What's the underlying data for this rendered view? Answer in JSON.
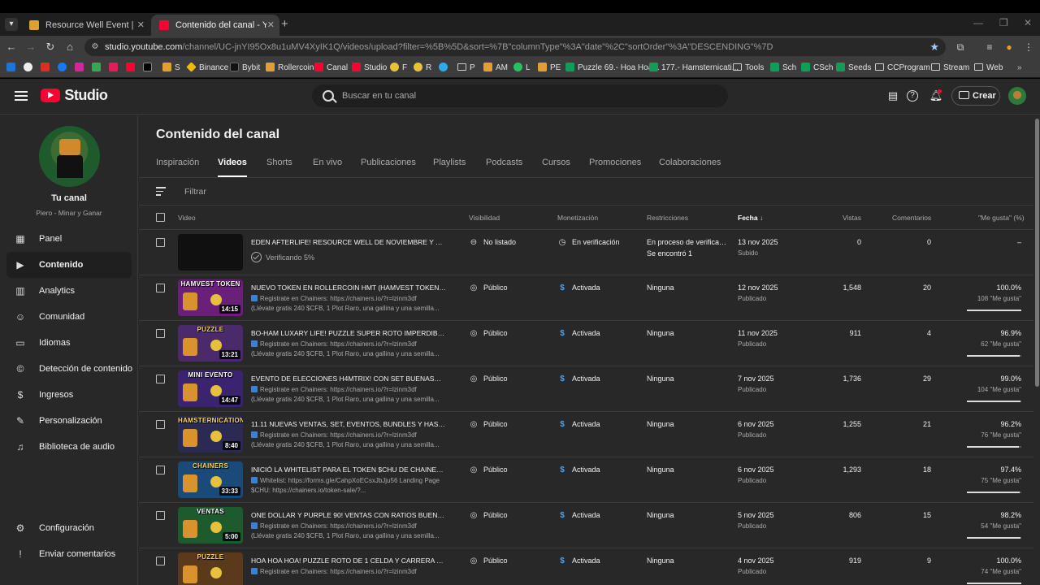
{
  "browser": {
    "tabs": [
      {
        "title": "Resource Well Event | RollerCoin",
        "active": false
      },
      {
        "title": "Contenido del canal - YouTube",
        "active": true
      }
    ],
    "url_main": "studio.youtube.com",
    "url_rest": "/channel/UC-jnYI95Ox8u1uMV4XyIK1Q/videos/upload?filter=%5B%5D&sort=%7B\"columnType\"%3A\"date\"%2C\"sortOrder\"%3A\"DESCENDING\"%7D",
    "bookmarks": [
      "S",
      "Binance",
      "Bybit",
      "Rollercoin",
      "Canal",
      "Studio",
      "F",
      "R",
      "P",
      "AM",
      "L",
      "PE",
      "Puzzle 69.- Hoa Hoa...",
      "177.- Hamsternicati...",
      "Tools",
      "Sch",
      "CSch",
      "Seeds",
      "CCProgram",
      "Stream",
      "Web"
    ]
  },
  "header": {
    "brand": "Studio",
    "search_placeholder": "Buscar en tu canal",
    "create_label": "Crear"
  },
  "sidebar": {
    "channel_title": "Tu canal",
    "channel_name": "Piero - Minar y Ganar",
    "items": [
      {
        "label": "Panel",
        "icon": "dashboard-icon"
      },
      {
        "label": "Contenido",
        "icon": "content-icon"
      },
      {
        "label": "Analytics",
        "icon": "analytics-icon"
      },
      {
        "label": "Comunidad",
        "icon": "community-icon"
      },
      {
        "label": "Idiomas",
        "icon": "subtitles-icon"
      },
      {
        "label": "Detección de contenido",
        "icon": "copyright-icon"
      },
      {
        "label": "Ingresos",
        "icon": "dollar-icon"
      },
      {
        "label": "Personalización",
        "icon": "magic-wand-icon"
      },
      {
        "label": "Biblioteca de audio",
        "icon": "audio-library-icon"
      }
    ],
    "bottom": [
      {
        "label": "Configuración",
        "icon": "gear-icon"
      },
      {
        "label": "Enviar comentarios",
        "icon": "feedback-icon"
      }
    ]
  },
  "content": {
    "title": "Contenido del canal",
    "tabs": [
      "Inspiración",
      "Videos",
      "Shorts",
      "En vivo",
      "Publicaciones",
      "Playlists",
      "Podcasts",
      "Cursos",
      "Promociones",
      "Colaboraciones"
    ],
    "active_tab": "Videos",
    "filter_placeholder": "Filtrar",
    "columns": {
      "video": "Video",
      "visibility": "Visibilidad",
      "monetization": "Monetización",
      "restrictions": "Restricciones",
      "date": "Fecha",
      "views": "Vistas",
      "comments": "Comentarios",
      "likes": "\"Me gusta\" (%)"
    },
    "rows": [
      {
        "thumb_text": "",
        "duration": "",
        "title": "EDEN AFTERLIFE! RESOURCE WELL DE NOVIEMBRE Y CHIS...",
        "desc1": "",
        "desc2": "",
        "processing": "Verificando 5%",
        "visibility": "No listado",
        "monetization": "En verificación",
        "restrictions": "En proceso de verificac...",
        "restrictions2": "Se encontró 1",
        "date": "13 nov 2025",
        "date_status": "Subido",
        "views": "0",
        "comments": "0",
        "likes_pct": "–",
        "likes_count": "",
        "likes_ratio": null
      },
      {
        "thumb_text": "HAMVEST TOKEN",
        "duration": "14:15",
        "title": "NUEVO TOKEN EN ROLLERCOIN HMT (HAMVEST TOKEN), P...",
        "desc1": "Registrate en Chainers: https://chainers.io/?r=lzinm3df",
        "desc2": "(Llévate gratis 240 $CFB, 1 Plot Raro, una gallina y una semilla...",
        "processing": "",
        "visibility": "Público",
        "monetization": "Activada",
        "restrictions": "Ninguna",
        "restrictions2": "",
        "date": "12 nov 2025",
        "date_status": "Publicado",
        "views": "1,548",
        "comments": "20",
        "likes_pct": "100.0%",
        "likes_count": "108 \"Me gusta\"",
        "likes_ratio": 1.0
      },
      {
        "thumb_text": "PUZZLE",
        "duration": "13:21",
        "title": "BO-HAM LUXARY LIFE! PUZZLE SUPER ROTO IMPERDIBLE, D...",
        "desc1": "Registrate en Chainers: https://chainers.io/?r=lzinm3df",
        "desc2": "(Llévate gratis 240 $CFB, 1 Plot Raro, una gallina y una semilla...",
        "processing": "",
        "visibility": "Público",
        "monetization": "Activada",
        "restrictions": "Ninguna",
        "restrictions2": "",
        "date": "11 nov 2025",
        "date_status": "Publicado",
        "views": "911",
        "comments": "4",
        "likes_pct": "96.9%",
        "likes_count": "62 \"Me gusta\"",
        "likes_ratio": 0.969
      },
      {
        "thumb_text": "MINI EVENTO",
        "duration": "14:47",
        "title": "EVENTO DE ELECCIONES H4MTRIX! CON SET BUENASO PO...",
        "desc1": "Registrate en Chainers: https://chainers.io/?r=lzinm3df",
        "desc2": "(Llévate gratis 240 $CFB, 1 Plot Raro, una gallina y una semilla...",
        "processing": "",
        "visibility": "Público",
        "monetization": "Activada",
        "restrictions": "Ninguna",
        "restrictions2": "",
        "date": "7 nov 2025",
        "date_status": "Publicado",
        "views": "1,736",
        "comments": "29",
        "likes_pct": "99.0%",
        "likes_count": "104 \"Me gusta\"",
        "likes_ratio": 0.99
      },
      {
        "thumb_text": "HAMSTERNICATION",
        "duration": "8:40",
        "title": "11.11 NUEVAS VENTAS, SET, EVENTOS, BUNDLES Y HASTA ...",
        "desc1": "Registrate en Chainers: https://chainers.io/?r=lzinm3df",
        "desc2": "(Llévate gratis 240 $CFB, 1 Plot Raro, una gallina y una semilla...",
        "processing": "",
        "visibility": "Público",
        "monetization": "Activada",
        "restrictions": "Ninguna",
        "restrictions2": "",
        "date": "6 nov 2025",
        "date_status": "Publicado",
        "views": "1,255",
        "comments": "21",
        "likes_pct": "96.2%",
        "likes_count": "76 \"Me gusta\"",
        "likes_ratio": 0.962
      },
      {
        "thumb_text": "CHAINERS",
        "duration": "33:33",
        "title": "INICIÓ LA WHITELIST PARA EL TOKEN $CHU DE CHAINERS! ...",
        "desc1": "Whitelist: https://forms.gle/CahpXoECsxJbJju56 Landing Page",
        "desc2": "$CHU: https://chainers.io/token-sale/?...",
        "processing": "",
        "visibility": "Público",
        "monetization": "Activada",
        "restrictions": "Ninguna",
        "restrictions2": "",
        "date": "6 nov 2025",
        "date_status": "Publicado",
        "views": "1,293",
        "comments": "18",
        "likes_pct": "97.4%",
        "likes_count": "75 \"Me gusta\"",
        "likes_ratio": 0.974
      },
      {
        "thumb_text": "VENTAS",
        "duration": "5:00",
        "title": "ONE DOLLAR Y PURPLE 90! VENTAS CON RATIOS BUENISIM...",
        "desc1": "Registrate en Chainers: https://chainers.io/?r=lzinm3df",
        "desc2": "(Llévate gratis 240 $CFB, 1 Plot Raro, una gallina y una semilla...",
        "processing": "",
        "visibility": "Público",
        "monetization": "Activada",
        "restrictions": "Ninguna",
        "restrictions2": "",
        "date": "5 nov 2025",
        "date_status": "Publicado",
        "views": "806",
        "comments": "15",
        "likes_pct": "98.2%",
        "likes_count": "54 \"Me gusta\"",
        "likes_ratio": 0.982
      },
      {
        "thumb_text": "PUZZLE",
        "duration": "",
        "title": "HOA HOA HOA! PUZZLE ROTO DE 1 CELDA Y CARRERA DE C...",
        "desc1": "Registrate en Chainers: https://chainers.io/?r=lzinm3df",
        "desc2": "",
        "processing": "",
        "visibility": "Público",
        "monetization": "Activada",
        "restrictions": "Ninguna",
        "restrictions2": "",
        "date": "4 nov 2025",
        "date_status": "Publicado",
        "views": "919",
        "comments": "9",
        "likes_pct": "100.0%",
        "likes_count": "74 \"Me gusta\"",
        "likes_ratio": 1.0
      }
    ]
  },
  "colors": {
    "page_bg": "#282828",
    "youtube_red": "#ff0033",
    "monetization_icon": "#3ea6ff"
  }
}
